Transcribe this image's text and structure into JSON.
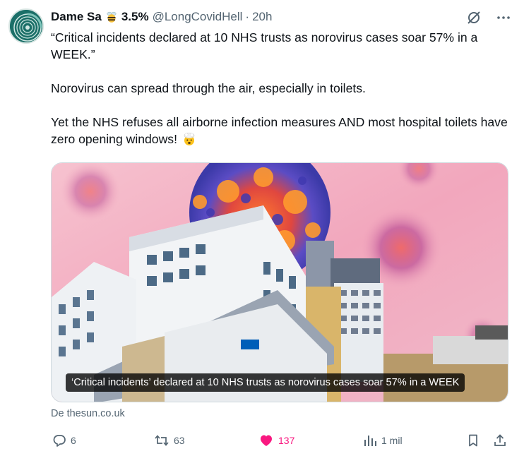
{
  "author": {
    "name": "Dame Sa",
    "badge_emoji": "bee",
    "status": "3.5%",
    "handle": "@LongCovidHell",
    "separator": "·",
    "time": "20h"
  },
  "top_icons": [
    "grok-icon",
    "more-icon"
  ],
  "body": {
    "line1": "“Critical incidents declared at 10 NHS trusts as norovirus cases soar 57% in a WEEK.”",
    "line2": "Norovirus can spread through the air, especially in toilets.",
    "line3": "Yet the NHS refuses all airborne infection measures AND most hospital toilets have zero opening windows!",
    "line3_emoji": "exploding-head"
  },
  "media": {
    "caption": "‘Critical incidents’ declared at 10 NHS trusts as norovirus cases soar 57% in a WEEK"
  },
  "source": "De thesun.co.uk",
  "actions": {
    "replies": "6",
    "reposts": "63",
    "likes": "137",
    "views": "1 mil"
  },
  "colors": {
    "text": "#0f1419",
    "secondary": "#536471",
    "like": "#f91880",
    "border": "#cfd9de"
  }
}
